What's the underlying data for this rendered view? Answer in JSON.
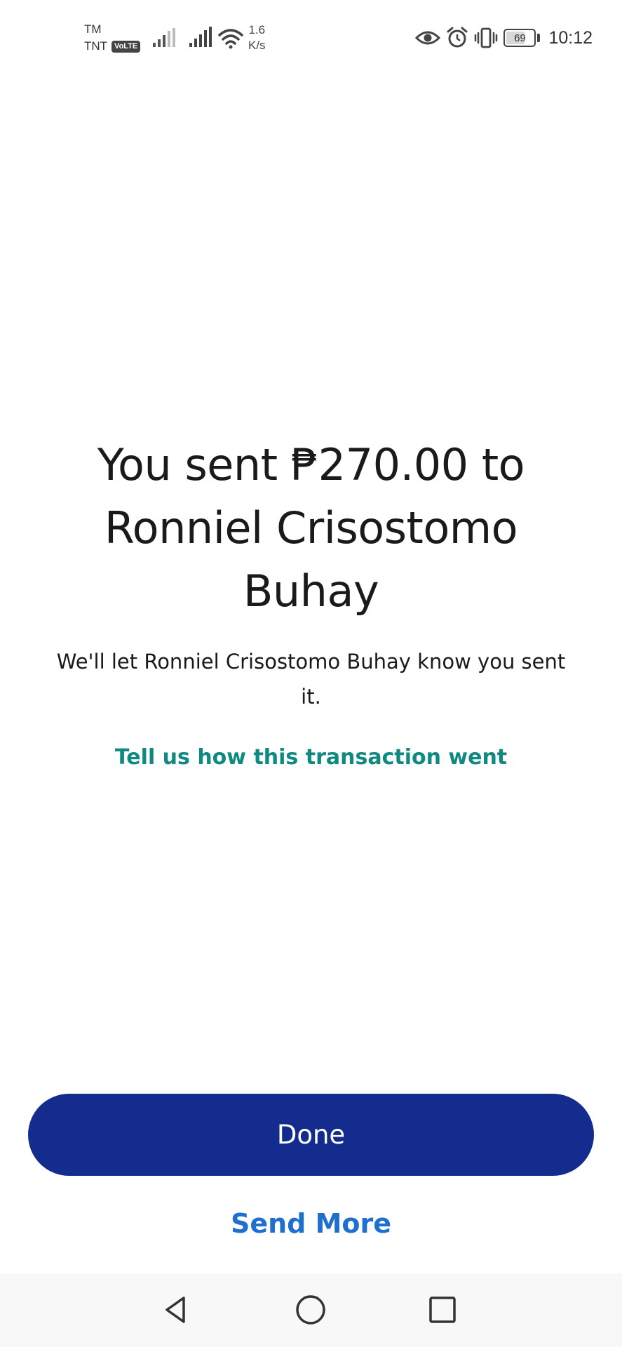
{
  "status_bar": {
    "carrier_top": "TM",
    "carrier_bottom": "TNT",
    "volte": "VoLTE",
    "net_speed_value": "1.6",
    "net_speed_unit": "K/s",
    "battery": "69",
    "battery_level": 0.69,
    "time": "10:12",
    "icons": [
      "signal-icon",
      "signal-icon",
      "wifi-icon",
      "eye-icon",
      "alarm-icon",
      "vibrate-icon",
      "battery-icon"
    ]
  },
  "confirmation": {
    "headline": "You sent ₱270.00 to Ronniel Crisostomo Buhay",
    "message": "We'll let Ronniel Crisostomo Buhay know you sent it.",
    "feedback_link": "Tell us how this transaction went"
  },
  "actions": {
    "done_label": "Done",
    "send_more_label": "Send More"
  },
  "nav_bar": {
    "icons": [
      "back-icon",
      "home-icon",
      "recents-icon"
    ]
  },
  "colors": {
    "primary_button": "#142c8e",
    "link_teal": "#108a80",
    "link_blue": "#1e6fd0",
    "text": "#1a1a1a"
  }
}
